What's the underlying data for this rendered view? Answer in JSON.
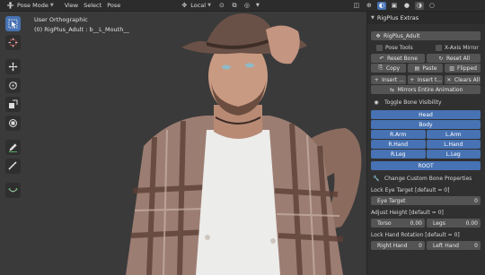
{
  "header": {
    "mode": "Pose Mode",
    "menus": [
      "View",
      "Select",
      "Pose"
    ],
    "transform_orientation": "Local"
  },
  "viewport": {
    "view_name": "User Orthographic",
    "active_object": "(0) RigPlus_Adult : b__L_Mouth__"
  },
  "panel": {
    "title": "RigPlus Extras",
    "rig_name": "RigPlus_Adult",
    "pose_tools_label": "Pose Tools",
    "x_axis_mirror_label": "X-Axis Mirror",
    "reset_bone_label": "Reset Bone",
    "reset_all_label": "Reset All",
    "copy_label": "Copy",
    "paste_label": "Paste",
    "flipped_label": "Flipped",
    "insert_1_label": "Insert ...",
    "insert_2_label": "Insert t...",
    "clears_all_label": "Clears All",
    "mirrors_anim_label": "Mirrors Entire Animation",
    "toggle_visibility_label": "Toggle Bone Visibility",
    "bone_buttons": {
      "head": "Head",
      "body": "Body",
      "r_arm": "R.Arm",
      "l_arm": "L.Arm",
      "r_hand": "R.Hand",
      "l_hand": "L.Hand",
      "r_leg": "R.Leg",
      "l_leg": "L.Leg",
      "root": "ROOT"
    },
    "change_props_label": "Change Custom Bone Properties",
    "lock_eye_label": "Lock Eye Target [default = 0]",
    "eye_target": {
      "label": "Eye Target",
      "value": "0"
    },
    "adjust_height_label": "Adjust Height [default = 0]",
    "torso": {
      "label": "Torso",
      "value": "0.00"
    },
    "legs": {
      "label": "Legs",
      "value": "0.00"
    },
    "lock_hand_label": "Lock Hand Rotation [default = 0]",
    "right_hand": {
      "label": "Right Hand",
      "value": "0"
    },
    "left_hand": {
      "label": "Left Hand",
      "value": "0"
    }
  },
  "colors": {
    "accent_blue": "#4772b3",
    "panel_bg": "#303030",
    "header_bg": "#2c2c2c",
    "viewport_bg": "#3a3a3a"
  }
}
